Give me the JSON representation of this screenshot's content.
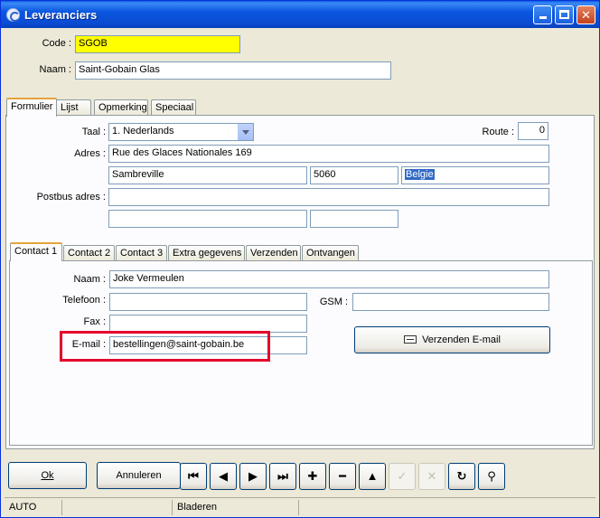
{
  "window": {
    "title": "Leveranciers"
  },
  "header": {
    "code_label": "Code :",
    "code_value": "SGOB",
    "naam_label": "Naam :",
    "naam_value": "Saint-Gobain Glas"
  },
  "main_tabs": [
    "Formulier",
    "Lijst",
    "Opmerking",
    "Speciaal"
  ],
  "formulier": {
    "taal_label": "Taal :",
    "taal_value": "1.  Nederlands",
    "route_label": "Route :",
    "route_value": "0",
    "adres_label": "Adres :",
    "adres_street": "Rue des Glaces Nationales 169",
    "adres_city": "Sambreville",
    "adres_postcode": "5060",
    "adres_country": "Belgie",
    "postbus_label": "Postbus adres :",
    "postbus_value": "",
    "postbus_city": "",
    "postbus_postcode": ""
  },
  "contact_tabs": [
    "Contact 1",
    "Contact 2",
    "Contact 3",
    "Extra gegevens",
    "Verzenden",
    "Ontvangen"
  ],
  "contact": {
    "naam_label": "Naam :",
    "naam_value": "Joke Vermeulen",
    "telefoon_label": "Telefoon :",
    "telefoon_value": "",
    "gsm_label": "GSM :",
    "gsm_value": "",
    "fax_label": "Fax :",
    "fax_value": "",
    "email_label": "E-mail :",
    "email_value": "bestellingen@saint-gobain.be",
    "send_email_label": "Verzenden E-mail"
  },
  "buttons": {
    "ok": "Ok",
    "annuleren": "Annuleren"
  },
  "nav_icons": [
    "first-record-icon",
    "previous-record-icon",
    "next-record-icon",
    "last-record-icon",
    "add-record-icon",
    "delete-record-icon",
    "scroll-up-icon",
    "confirm-icon",
    "cancel-edit-icon",
    "refresh-icon",
    "search-binoculars-icon"
  ],
  "statusbar": {
    "mode": "AUTO",
    "cell2": "",
    "state": "Bladeren"
  },
  "colors": {
    "code_field": "#ffff00",
    "highlight_box": "#e4002b",
    "titlebar": "#0a57e0"
  }
}
